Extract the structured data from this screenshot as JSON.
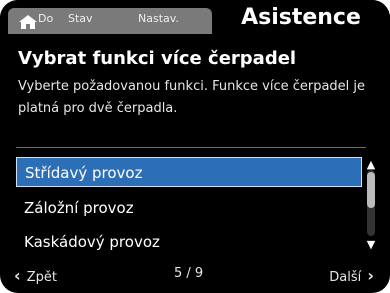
{
  "header": {
    "tabs": [
      {
        "label": "Do"
      },
      {
        "label": "Stav"
      },
      {
        "label": "Nastav."
      }
    ],
    "active_tab_label": "Asistence",
    "icons": [
      "home-icon"
    ]
  },
  "main": {
    "title": "Vybrat funkci více čerpadel",
    "description": "Vyberte požadovanou funkci. Funkce více čerpadel je platná pro dvě čerpadla."
  },
  "list": {
    "items": [
      {
        "label": "Střídavý provoz",
        "selected": true
      },
      {
        "label": "Záložní provoz",
        "selected": false
      },
      {
        "label": "Kaskádový provoz",
        "selected": false
      }
    ]
  },
  "footer": {
    "back_label": "Zpět",
    "page_indicator": "5 / 9",
    "next_label": "Další"
  },
  "colors": {
    "background": "#000000",
    "tab_bg": "#7a7a7a",
    "selection": "#2d6fb7"
  }
}
